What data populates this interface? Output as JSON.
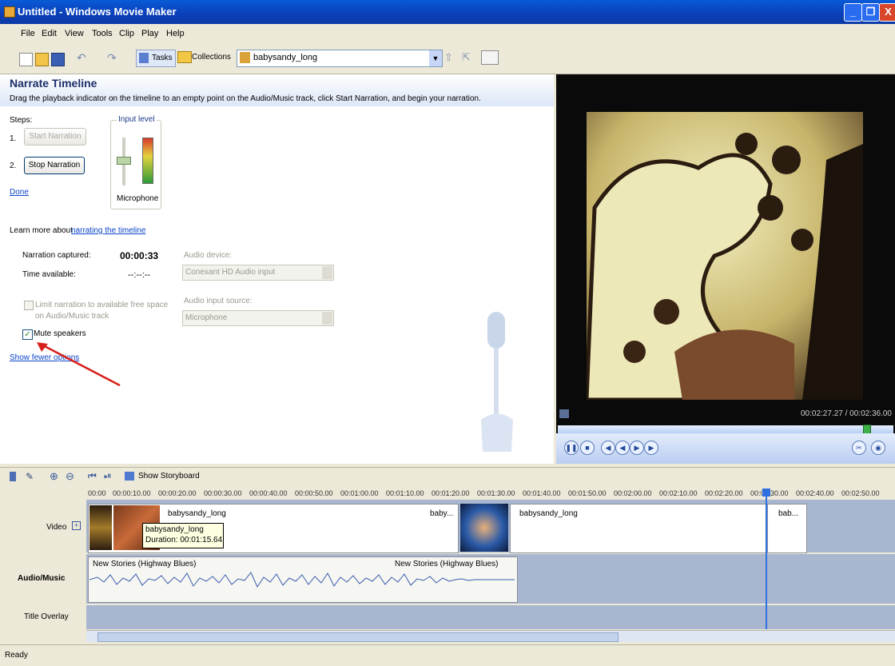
{
  "window": {
    "title": "Untitled - Windows Movie Maker",
    "min": "_",
    "max": "❐",
    "close": "X"
  },
  "menu": [
    "File",
    "Edit",
    "View",
    "Tools",
    "Clip",
    "Play",
    "Help"
  ],
  "toolbar": {
    "tasks": "Tasks",
    "collections": "Collections",
    "collection_value": "babysandy_long"
  },
  "narrate": {
    "title": "Narrate Timeline",
    "description": "Drag the playback indicator on the timeline to an empty point on the Audio/Music track, click Start Narration, and begin your narration.",
    "steps_label": "Steps:",
    "step1_num": "1.",
    "step2_num": "2.",
    "start_button": "Start Narration",
    "stop_button": "Stop Narration",
    "done_link": "Done",
    "input_level_label": "Input level",
    "microphone_label": "Microphone",
    "learn_more_text": "Learn more about",
    "learn_more_link": "narrating the timeline",
    "narration_captured_label": "Narration captured:",
    "narration_captured_value": "00:00:33",
    "time_available_label": "Time available:",
    "time_available_value": "--:--:--",
    "audio_device_label": "Audio device:",
    "audio_device_value": "Conexant HD Audio input",
    "audio_source_label": "Audio input source:",
    "audio_source_value": "Microphone",
    "limit_label_1": "Limit narration to available free space",
    "limit_label_2": "on Audio/Music track",
    "mute_label": "Mute speakers",
    "show_fewer_link": "Show fewer options"
  },
  "preview": {
    "time": "00:02:27.27 / 00:02:36.00"
  },
  "timeline": {
    "show_storyboard": "Show Storyboard",
    "ticks": [
      "00:00",
      "00:00:10.00",
      "00:00:20.00",
      "00:00:30.00",
      "00:00:40.00",
      "00:00:50.00",
      "00:01:00.00",
      "00:01:10.00",
      "00:01:20.00",
      "00:01:30.00",
      "00:01:40.00",
      "00:01:50.00",
      "00:02:00.00",
      "00:02:10.00",
      "00:02:20.00",
      "00:02:30.00",
      "00:02:40.00",
      "00:02:50.00"
    ],
    "tracks": {
      "video": "Video",
      "audio": "Audio/Music",
      "overlay": "Title Overlay"
    },
    "clip1_name": "babysandy_long",
    "clip1_short": "baby...",
    "clip2_name": "babysandy_long",
    "clip3_short": "bab...",
    "tooltip_name": "babysandy_long",
    "tooltip_duration": "Duration: 00:01:15.64",
    "audio1": "New Stories (Highway Blues)",
    "audio2": "New Stories (Highway Blues)"
  },
  "status": "Ready"
}
